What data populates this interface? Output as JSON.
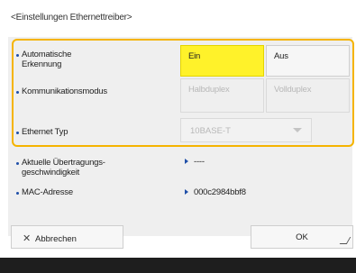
{
  "title": "<Einstellungen Ethernettreiber>",
  "settings": {
    "auto_detect": {
      "label": "Automatische Erkennung",
      "label_line1": "Automatische",
      "label_line2": "Erkennung",
      "options": [
        "Ein",
        "Aus"
      ],
      "selected": "Ein"
    },
    "comm_mode": {
      "label": "Kommunikationsmodus",
      "options": [
        "Halbduplex",
        "Vollduplex"
      ],
      "disabled": true
    },
    "ethernet_type": {
      "label": "Ethernet Typ",
      "value": "10BASE-T",
      "disabled": true
    }
  },
  "info": {
    "speed": {
      "label_line1": "Aktuelle Übertragungs-",
      "label_line2": "geschwindigkeit",
      "value": "----"
    },
    "mac": {
      "label": "MAC-Adresse",
      "value": "000c2984bbf8"
    }
  },
  "footer": {
    "cancel_label": "Abbrechen",
    "ok_label": "OK"
  },
  "colors": {
    "selected": "#fff22a",
    "highlight_border": "#f5b400",
    "bullet": "#1f4fa8"
  }
}
